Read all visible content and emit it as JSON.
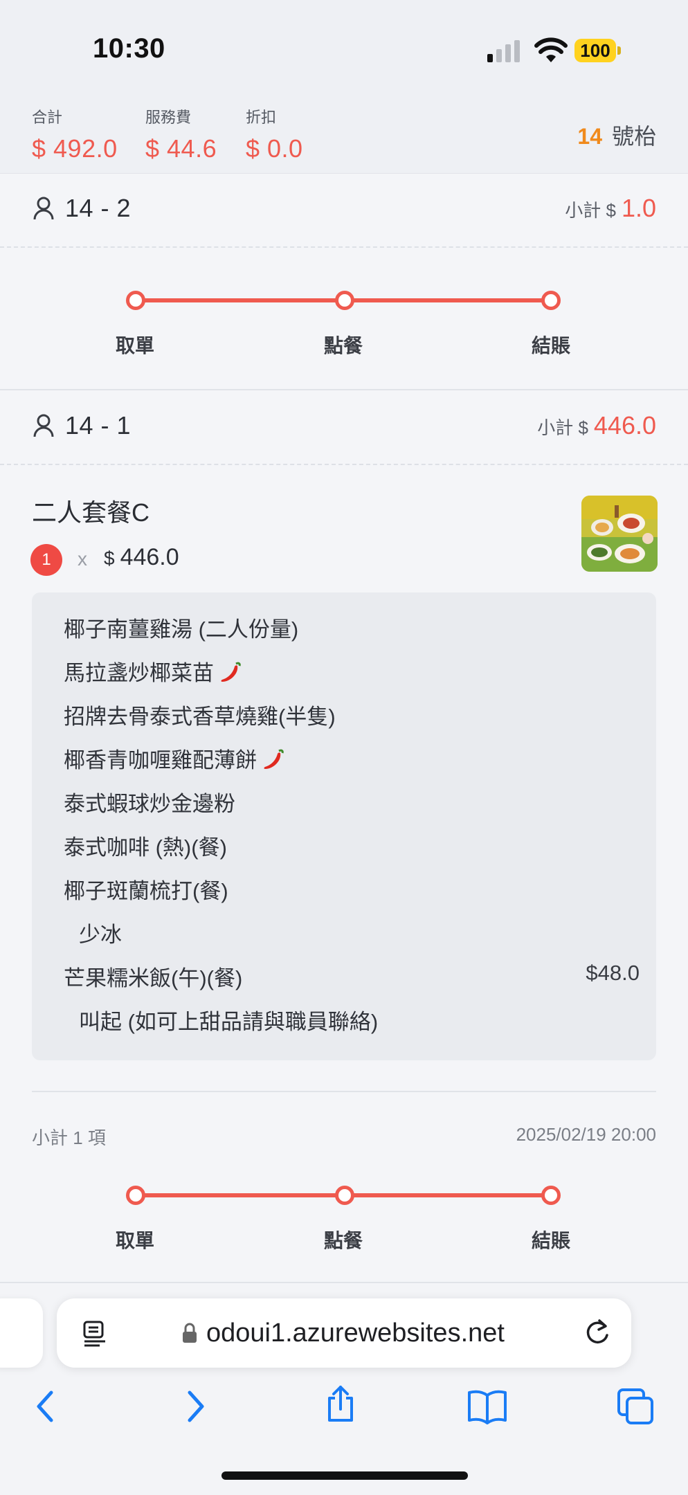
{
  "status_bar": {
    "time": "10:30",
    "battery": "100"
  },
  "summary": {
    "total_label": "合計",
    "total_value": "$ 492.0",
    "service_label": "服務費",
    "service_value": "$ 44.6",
    "discount_label": "折扣",
    "discount_value": "$ 0.0",
    "table_number": "14",
    "table_suffix": "號枱"
  },
  "orders": [
    {
      "id": "14 - 2",
      "subtotal_label": "小計 $",
      "subtotal_value": "1.0",
      "progress": [
        "取單",
        "點餐",
        "結賬"
      ]
    },
    {
      "id": "14 - 1",
      "subtotal_label": "小計 $",
      "subtotal_value": "446.0",
      "item": {
        "name": "二人套餐C",
        "quantity": "1",
        "times": "x",
        "currency": "$",
        "price": "446.0",
        "details": [
          {
            "text": "椰子南薑雞湯 (二人份量)"
          },
          {
            "text": "馬拉盞炒椰菜苗",
            "spicy": true
          },
          {
            "text": "招牌去骨泰式香草燒雞(半隻)"
          },
          {
            "text": "椰香青咖喱雞配薄餅",
            "spicy": true
          },
          {
            "text": "泰式蝦球炒金邊粉"
          },
          {
            "text": "泰式咖啡 (熱)(餐)"
          },
          {
            "text": "椰子斑蘭梳打(餐)"
          },
          {
            "text": "少冰",
            "sub": true
          },
          {
            "text": "芒果糯米飯(午)(餐)",
            "price": "$48.0"
          },
          {
            "text": "叫起 (如可上甜品請與職員聯絡)",
            "sub": true
          }
        ]
      },
      "footer_count": "小計 1 項",
      "footer_time": "2025/02/19 20:00",
      "progress": [
        "取單",
        "點餐",
        "結賬"
      ]
    }
  ],
  "browser": {
    "url": "odoui1.azurewebsites.net",
    "icons": [
      "reader-icon",
      "lock-icon",
      "reload-icon",
      "back-icon",
      "forward-icon",
      "share-icon",
      "bookmarks-icon",
      "tabs-icon"
    ]
  },
  "colors": {
    "accent": "#ef5a4f",
    "table_number": "#f08a1c",
    "badge": "#ef4a44",
    "link_blue": "#1a7cf5"
  }
}
